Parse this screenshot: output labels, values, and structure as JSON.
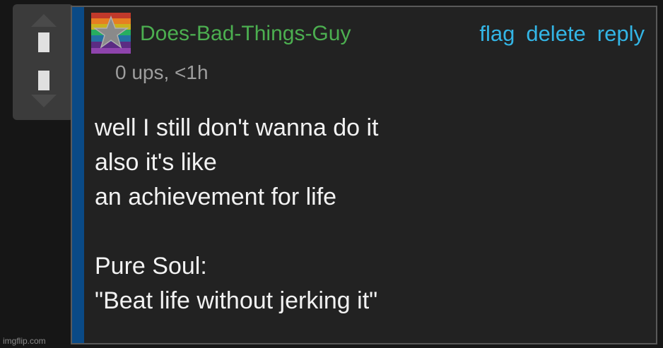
{
  "vote": {
    "up_icon": "arrow-up-icon",
    "down_icon": "arrow-down-icon"
  },
  "comment": {
    "avatar_icon": "rainbow-star-avatar",
    "username": "Does-Bad-Things-Guy",
    "meta": "0 ups, <1h",
    "actions": {
      "flag": "flag",
      "delete": "delete",
      "reply": "reply"
    },
    "body_lines": [
      "well I still don't wanna do it",
      "also it's like",
      "an achievement for life",
      "",
      "Pure Soul:",
      "\"Beat life without jerking it\""
    ]
  },
  "watermark": "imgflip.com",
  "colors": {
    "username": "#4caf50",
    "action_link": "#33b5e5",
    "accent_bar": "#0a4a86",
    "card_bg": "#222222"
  }
}
